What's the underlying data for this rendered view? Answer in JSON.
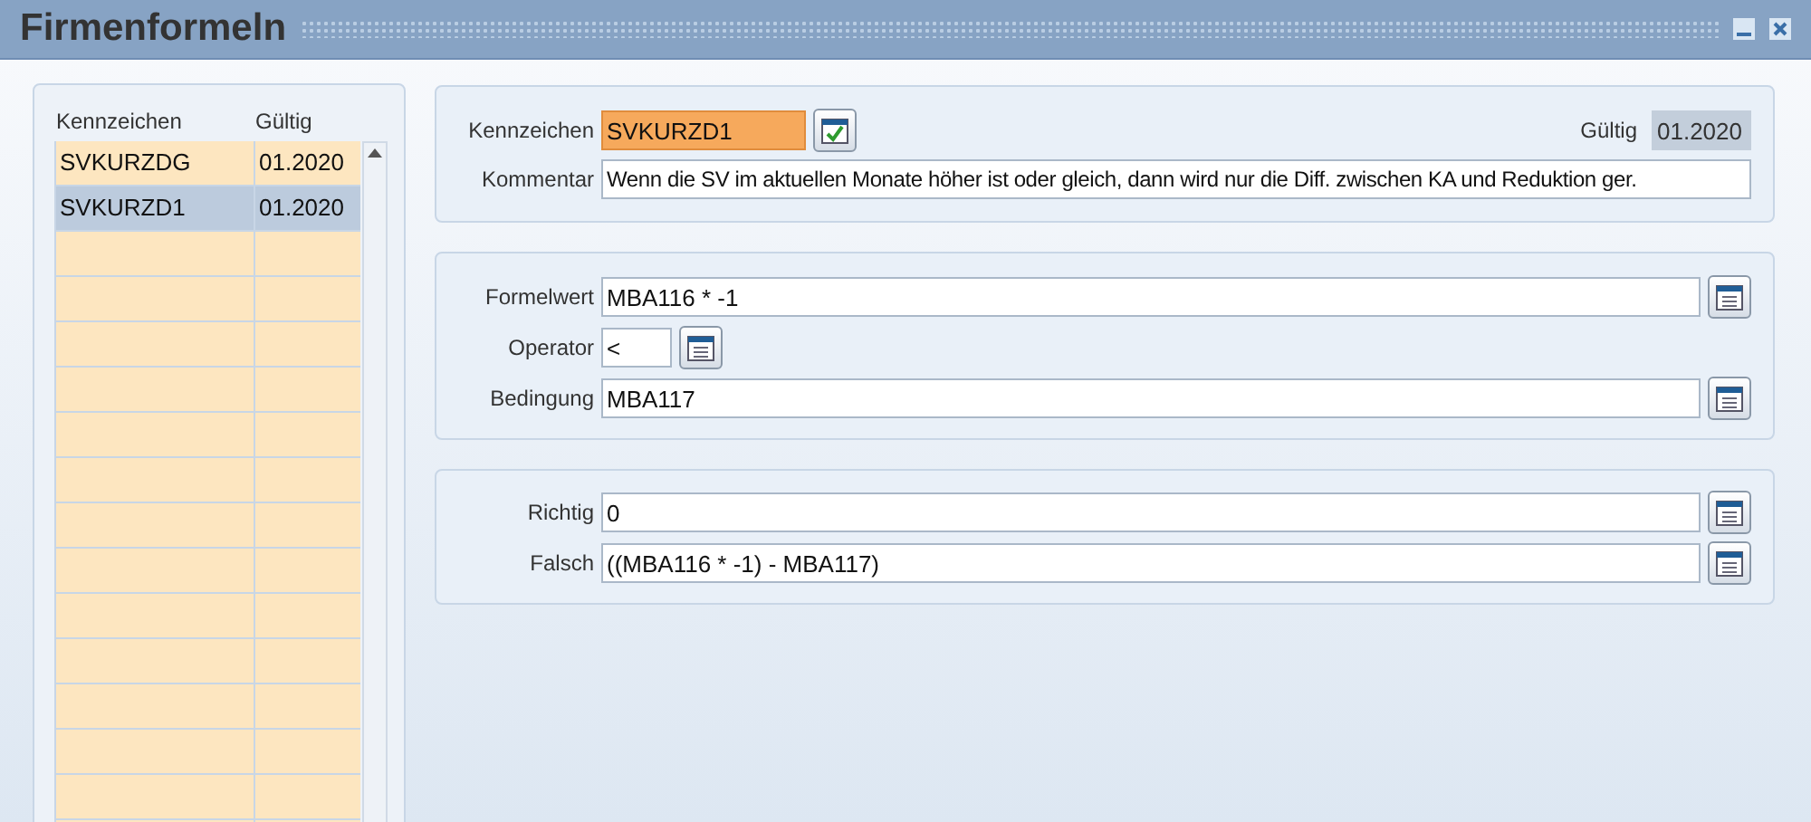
{
  "window": {
    "title": "Firmenformeln"
  },
  "list": {
    "columns": [
      "Kennzeichen",
      "Gültig"
    ],
    "rows": [
      {
        "cells": [
          "SVKURZDG",
          "01.2020"
        ],
        "selected": false
      },
      {
        "cells": [
          "SVKURZD1",
          "01.2020"
        ],
        "selected": true
      }
    ]
  },
  "header": {
    "kennzeichen": {
      "label": "Kennzeichen",
      "value": "SVKURZD1",
      "focused": true
    },
    "gueltig": {
      "label": "Gültig",
      "value": "01.2020",
      "readonly": true
    },
    "kommentar": {
      "label": "Kommentar",
      "value": "Wenn die SV im aktuellen Monate höher ist oder gleich, dann wird nur die Diff. zwischen KA und Reduktion ger."
    }
  },
  "sections": [
    {
      "fields": [
        {
          "label": "Formelwert",
          "value": "MBA116 * -1",
          "kind": "wide"
        },
        {
          "label": "Operator",
          "value": "<",
          "kind": "short"
        },
        {
          "label": "Bedingung",
          "value": "MBA117",
          "kind": "wide"
        }
      ]
    },
    {
      "fields": [
        {
          "label": "Richtig",
          "value": "0",
          "kind": "wide"
        },
        {
          "label": "Falsch",
          "value": "((MBA116 * -1) - MBA117)",
          "kind": "wide"
        }
      ]
    }
  ]
}
